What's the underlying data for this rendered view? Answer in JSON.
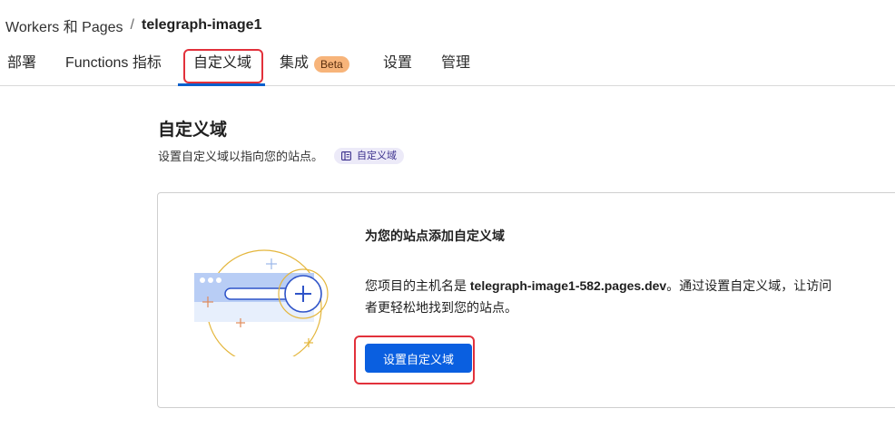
{
  "breadcrumb": {
    "parent": "Workers 和 Pages",
    "separator": "/",
    "current": "telegraph-image1"
  },
  "tabs": [
    {
      "label": "部署"
    },
    {
      "label": "Functions 指标"
    },
    {
      "label": "自定义域",
      "active": true
    },
    {
      "label": "集成",
      "badge": "Beta"
    },
    {
      "label": "设置"
    },
    {
      "label": "管理"
    }
  ],
  "section": {
    "title": "自定义域",
    "description": "设置自定义域以指向您的站点。",
    "doc_link": "自定义域"
  },
  "card": {
    "title": "为您的站点添加自定义域",
    "text_prefix": "您项目的主机名是 ",
    "hostname": "telegraph-image1-582.pages.dev",
    "text_suffix": "。通过设置自定义域，让访问者更轻松地找到您的站点。",
    "button_label": "设置自定义域"
  },
  "colors": {
    "accent_blue": "#0a5fe0",
    "highlight_red": "#e2313b",
    "beta_orange": "#f7b47a"
  }
}
